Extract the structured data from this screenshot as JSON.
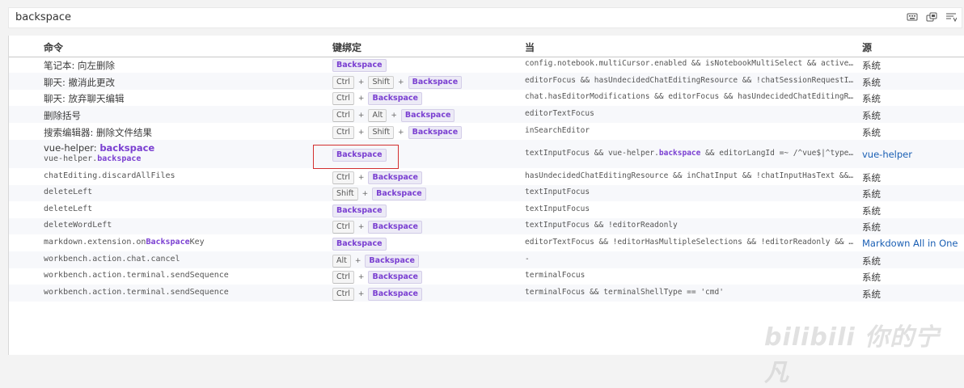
{
  "search": {
    "value": "backspace"
  },
  "search_icons": [
    "keyboard-icon",
    "record-keys-icon",
    "sort-icon"
  ],
  "headers": {
    "command": "命令",
    "keybinding": "键绑定",
    "when": "当",
    "source": "源"
  },
  "rows": [
    {
      "command": "笔记本: 向左删除",
      "keys": [
        "Backspace"
      ],
      "when": "config.notebook.multiCursor.enabled && isNotebookMultiSelect && activeEd…",
      "source": "系统"
    },
    {
      "command": "聊天: 撤消此更改",
      "keys": [
        "Ctrl",
        "Shift",
        "Backspace"
      ],
      "when": "editorFocus && hasUndecidedChatEditingResource && !chatSessionRequestInP…",
      "source": "系统"
    },
    {
      "command": "聊天: 放弃聊天编辑",
      "keys": [
        "Ctrl",
        "Backspace"
      ],
      "when": "chat.hasEditorModifications && editorFocus && hasUndecidedChatEditingRes…",
      "source": "系统"
    },
    {
      "command": "删除括号",
      "keys": [
        "Ctrl",
        "Alt",
        "Backspace"
      ],
      "when": "editorTextFocus",
      "source": "系统"
    },
    {
      "command": "搜索编辑器: 删除文件结果",
      "keys": [
        "Ctrl",
        "Shift",
        "Backspace"
      ],
      "when": "inSearchEditor",
      "source": "系统"
    },
    {
      "command": "vue-helper: backspace",
      "command_id": "vue-helper.backspace",
      "keys": [
        "Backspace"
      ],
      "when": "textInputFocus && vue-helper.backspace && editorLangId =~ /^vue$|^typesc…",
      "source": "vue-helper"
    },
    {
      "command": "chatEditing.discardAllFiles",
      "keys": [
        "Ctrl",
        "Backspace"
      ],
      "when": "hasUndecidedChatEditingResource && inChatInput && !chatInputHasText && !…",
      "source": "系统"
    },
    {
      "command": "deleteLeft",
      "keys": [
        "Shift",
        "Backspace"
      ],
      "when": "textInputFocus",
      "source": "系统"
    },
    {
      "command": "deleteLeft",
      "keys": [
        "Backspace"
      ],
      "when": "textInputFocus",
      "source": "系统"
    },
    {
      "command": "deleteWordLeft",
      "keys": [
        "Ctrl",
        "Backspace"
      ],
      "when": "textInputFocus && !editorReadonly",
      "source": "系统"
    },
    {
      "command": "markdown.extension.onBackspaceKey",
      "keys": [
        "Backspace"
      ],
      "when": "editorTextFocus && !editorHasMultipleSelections && !editorReadonly && !m…",
      "source": "Markdown All in One"
    },
    {
      "command": "workbench.action.chat.cancel",
      "keys": [
        "Alt",
        "Backspace"
      ],
      "when": "-",
      "source": "系统"
    },
    {
      "command": "workbench.action.terminal.sendSequence",
      "keys": [
        "Ctrl",
        "Backspace"
      ],
      "when": "terminalFocus",
      "source": "系统"
    },
    {
      "command": "workbench.action.terminal.sendSequence",
      "keys": [
        "Ctrl",
        "Backspace"
      ],
      "when": "terminalFocus && terminalShellType == 'cmd'",
      "source": "系统"
    }
  ],
  "highlight_term": "backspace",
  "colors": {
    "highlight": "#7a3fd1",
    "link": "#1a5fb4",
    "annotation_box": "#d32f2f"
  },
  "watermark": "bilibili 你的宁凡"
}
